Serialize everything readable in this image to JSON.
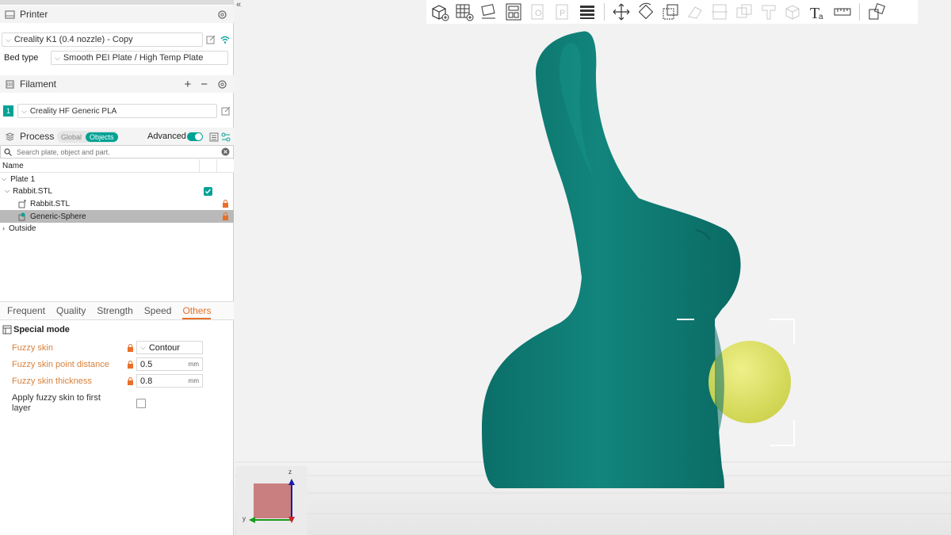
{
  "printer": {
    "header": "Printer",
    "preset": "Creality K1 (0.4 nozzle) - Copy",
    "bed_type_label": "Bed type",
    "bed_type_value": "Smooth PEI Plate / High Temp Plate"
  },
  "filament": {
    "header": "Filament",
    "slot": "1",
    "preset": "Creality HF Generic PLA",
    "add_symbol": "+",
    "remove_symbol": "−"
  },
  "process": {
    "header": "Process",
    "toggle_global": "Global",
    "toggle_objects": "Objects",
    "advanced_label": "Advanced"
  },
  "search": {
    "placeholder": "Search plate, object and part."
  },
  "tree": {
    "column_name": "Name",
    "plate": "Plate 1",
    "object": "Rabbit.STL",
    "part": "Rabbit.STL",
    "modifier": "Generic-Sphere",
    "outside": "Outside"
  },
  "tabs": [
    "Frequent",
    "Quality",
    "Strength",
    "Speed",
    "Others"
  ],
  "active_tab": "Others",
  "special_mode": {
    "header": "Special mode",
    "fuzzy_skin_label": "Fuzzy skin",
    "fuzzy_skin_value": "Contour",
    "point_distance_label": "Fuzzy skin point distance",
    "point_distance_value": "0.5",
    "point_distance_unit": "mm",
    "thickness_label": "Fuzzy skin thickness",
    "thickness_value": "0.8",
    "thickness_unit": "mm",
    "first_layer_label_1": "Apply fuzzy skin to first",
    "first_layer_label_2": "layer"
  },
  "axes": {
    "z": "z",
    "y": "y"
  },
  "colors": {
    "accent": "#00a295",
    "orange": "#e8702a",
    "model": "#0e7a72",
    "modifier": "#e2e85a"
  }
}
